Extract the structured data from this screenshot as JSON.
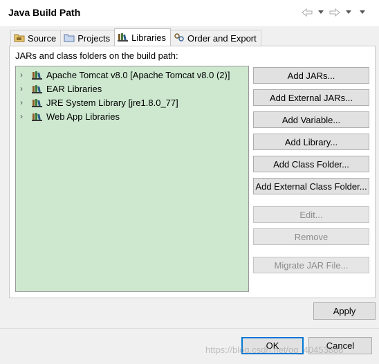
{
  "window": {
    "title": "Java Build Path"
  },
  "tabs": [
    {
      "label": "Source",
      "icon": "source-folder-icon",
      "active": false
    },
    {
      "label": "Projects",
      "icon": "projects-folder-icon",
      "active": false
    },
    {
      "label": "Libraries",
      "icon": "libraries-icon",
      "active": true
    },
    {
      "label": "Order and Export",
      "icon": "order-export-icon",
      "active": false
    }
  ],
  "libraries": {
    "label": "JARs and class folders on the build path:",
    "items": [
      {
        "label": "Apache Tomcat v8.0 [Apache Tomcat v8.0 (2)]"
      },
      {
        "label": "EAR Libraries"
      },
      {
        "label": "JRE System Library [jre1.8.0_77]"
      },
      {
        "label": "Web App Libraries"
      }
    ]
  },
  "buttons": {
    "add_jars": "Add JARs...",
    "add_external_jars": "Add External JARs...",
    "add_variable": "Add Variable...",
    "add_library": "Add Library...",
    "add_class_folder": "Add Class Folder...",
    "add_external_class_folder": "Add External Class Folder...",
    "edit": "Edit...",
    "remove": "Remove",
    "migrate_jar": "Migrate JAR File..."
  },
  "apply": "Apply",
  "ok": "OK",
  "cancel": "Cancel",
  "watermark": "https://blog.csdn.net/qq_40453888",
  "colors": {
    "tree_bg": "#cde8cf",
    "ok_border": "#0078d7",
    "dialog_bg": "#f0f0f0"
  }
}
